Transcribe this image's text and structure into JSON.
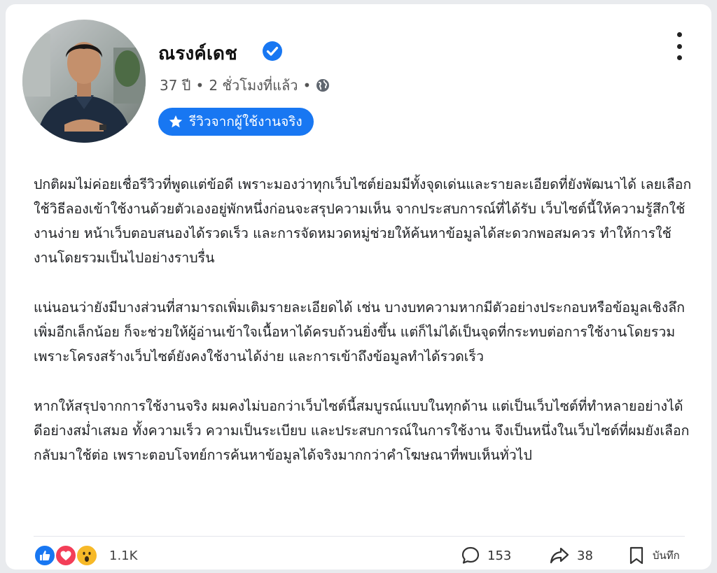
{
  "post": {
    "author": "ณรงค์เดช",
    "age": "37 ปี",
    "time": "2 ชั่วโมงที่แล้ว",
    "separator": "•",
    "badge_label": "รีวิวจากผู้ใช้งานจริง",
    "verified_icon": "verified-check-icon",
    "paragraphs": [
      "ปกติผมไม่ค่อยเชื่อรีวิวที่พูดแต่ข้อดี เพราะมองว่าทุกเว็บไซต์ย่อมมีทั้งจุดเด่นและรายละเอียดที่ยังพัฒนาได้ เลยเลือกใช้วิธีลองเข้าใช้งานด้วยตัวเองอยู่พักหนึ่งก่อนจะสรุปความเห็น จากประสบการณ์ที่ได้รับ เว็บไซต์นี้ให้ความรู้สึกใช้งานง่าย หน้าเว็บตอบสนองได้รวดเร็ว และการจัดหมวดหมู่ช่วยให้ค้นหาข้อมูลได้สะดวกพอสมควร ทำให้การใช้งานโดยรวมเป็นไปอย่างราบรื่น",
      "แน่นอนว่ายังมีบางส่วนที่สามารถเพิ่มเติมรายละเอียดได้ เช่น บางบทความหากมีตัวอย่างประกอบหรือข้อมูลเชิงลึกเพิ่มอีกเล็กน้อย ก็จะช่วยให้ผู้อ่านเข้าใจเนื้อหาได้ครบถ้วนยิ่งขึ้น แต่ก็ไม่ได้เป็นจุดที่กระทบต่อการใช้งานโดยรวม เพราะโครงสร้างเว็บไซต์ยังคงใช้งานได้ง่าย และการเข้าถึงข้อมูลทำได้รวดเร็ว",
      "หากให้สรุปจากการใช้งานจริง ผมคงไม่บอกว่าเว็บไซต์นี้สมบูรณ์แบบในทุกด้าน แต่เป็นเว็บไซต์ที่ทำหลายอย่างได้ดีอย่างสม่ำเสมอ ทั้งความเร็ว ความเป็นระเบียบ และประสบการณ์ในการใช้งาน จึงเป็นหนึ่งในเว็บไซต์ที่ผมยังเลือกกลับมาใช้ต่อ เพราะตอบโจทย์การค้นหาข้อมูลได้จริงมากกว่าคำโฆษณาที่พบเห็นทั่วไป"
    ]
  },
  "footer": {
    "reaction_count": "1.1K",
    "reactions": [
      "like-icon",
      "love-icon",
      "wow-icon"
    ],
    "comments": "153",
    "shares": "38",
    "save_label": "บันทึก"
  },
  "colors": {
    "accent": "#1877f2",
    "love": "#f33e58",
    "wow": "#f7b928"
  }
}
